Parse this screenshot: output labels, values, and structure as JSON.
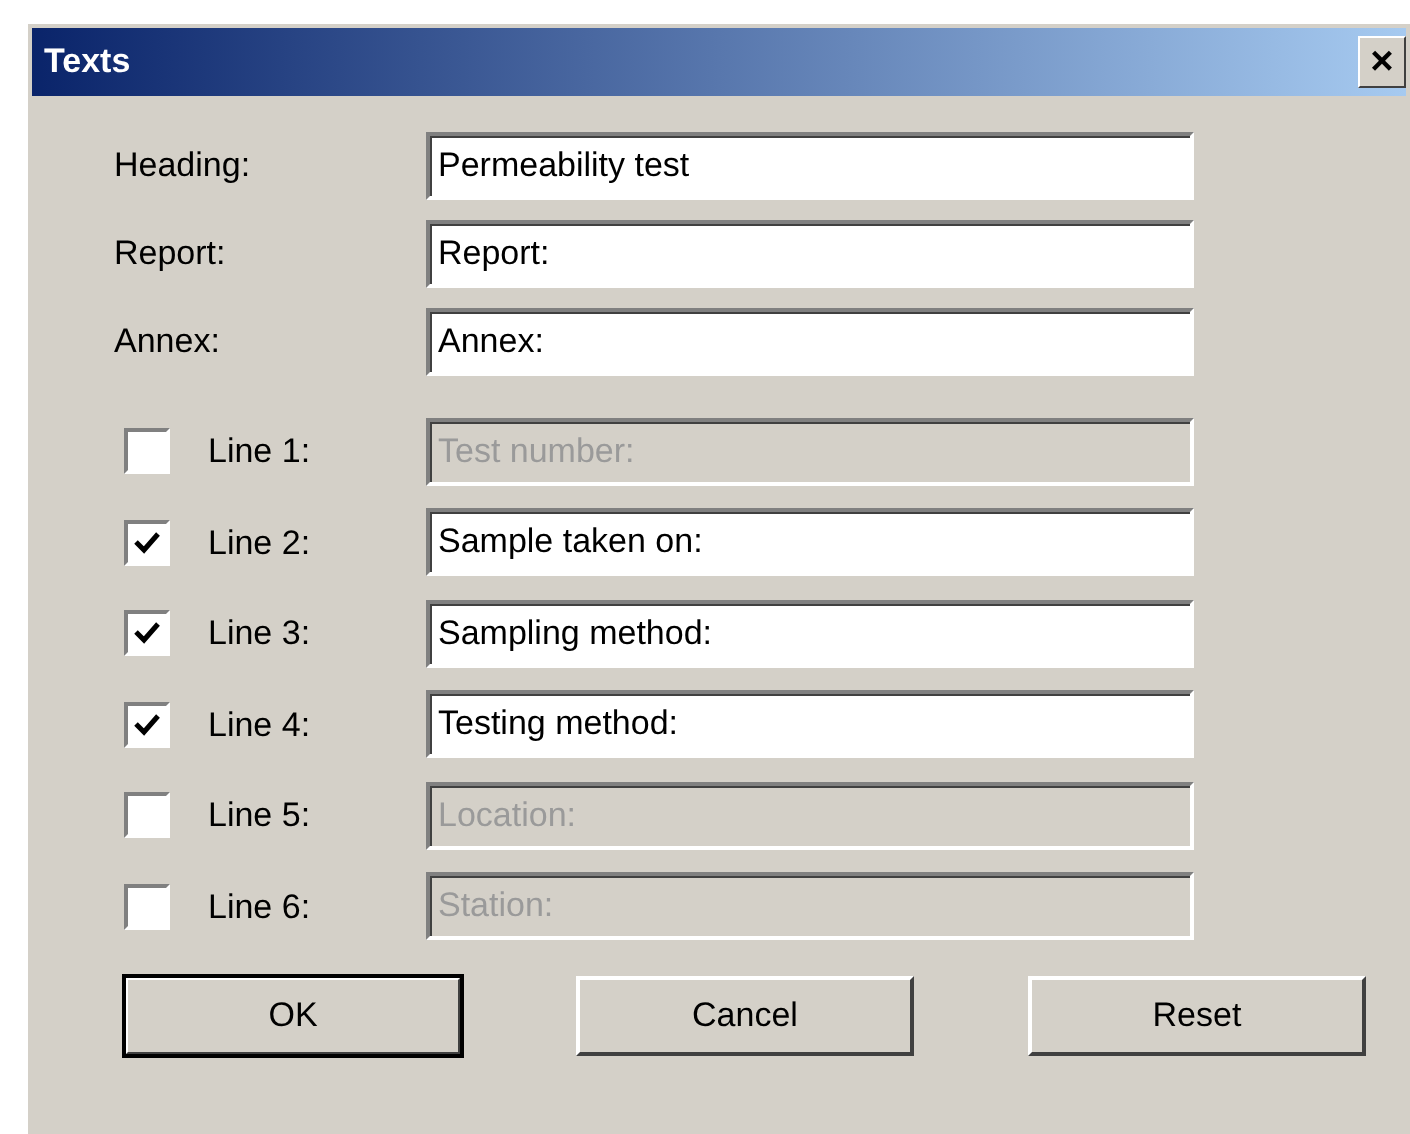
{
  "window": {
    "title": "Texts",
    "close": "×"
  },
  "fields": [
    {
      "label": "Heading:",
      "value": "Permeability test"
    },
    {
      "label": "Report:",
      "value": "Report:"
    },
    {
      "label": "Annex:",
      "value": "Annex:"
    }
  ],
  "lines": [
    {
      "label": "Line 1:",
      "checked": false,
      "value": "Test number:",
      "disabled": true
    },
    {
      "label": "Line 2:",
      "checked": true,
      "value": "Sample taken on:",
      "disabled": false
    },
    {
      "label": "Line 3:",
      "checked": true,
      "value": "Sampling method:",
      "disabled": false
    },
    {
      "label": "Line 4:",
      "checked": true,
      "value": "Testing method:",
      "disabled": false
    },
    {
      "label": "Line 5:",
      "checked": false,
      "value": "Location:",
      "disabled": true
    },
    {
      "label": "Line 6:",
      "checked": false,
      "value": "Station:",
      "disabled": true
    }
  ],
  "buttons": [
    {
      "label": "OK",
      "default": true
    },
    {
      "label": "Cancel",
      "default": false
    },
    {
      "label": "Reset",
      "default": false
    }
  ]
}
